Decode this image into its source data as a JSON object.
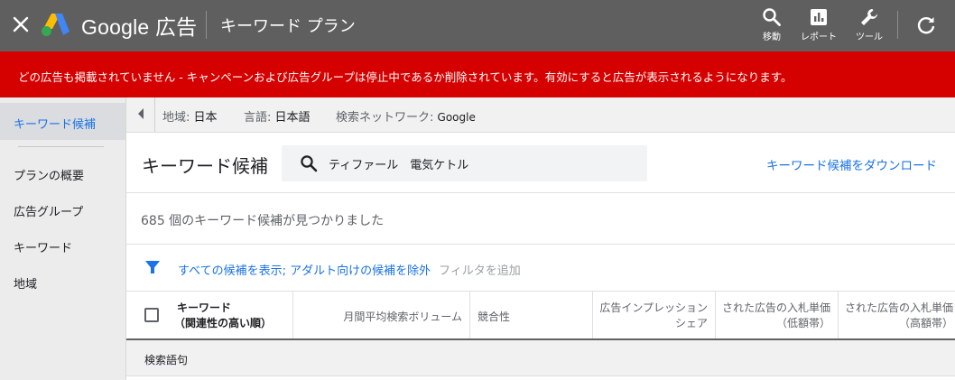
{
  "topbar": {
    "brand": "Google 広告",
    "page_title": "キーワード プラン",
    "tools": [
      {
        "label": "移動",
        "icon": "search-icon"
      },
      {
        "label": "レポート",
        "icon": "report-icon"
      },
      {
        "label": "ツール",
        "icon": "wrench-icon"
      }
    ],
    "background": "#5f5f5f"
  },
  "alert": {
    "text": "どの広告も掲載されていません - キャンペーンおよび広告グループは停止中であるか削除されています。有効にすると広告が表示されるようになります。",
    "color": "#d50000"
  },
  "sidebar": {
    "items": [
      {
        "label": "キーワード候補",
        "active": true
      },
      {
        "label": "プランの概要"
      },
      {
        "label": "広告グループ"
      },
      {
        "label": "キーワード"
      },
      {
        "label": "地域"
      }
    ]
  },
  "filterbar": {
    "region_label": "地域:",
    "region_value": "日本",
    "language_label": "言語:",
    "language_value": "日本語",
    "network_label": "検索ネットワーク:",
    "network_value": "Google"
  },
  "main": {
    "title": "キーワード候補",
    "search_value": "ティファール　電気ケトル",
    "download_link": "キーワード候補をダウンロード",
    "found_text": "685 個のキーワード候補が見つかりました",
    "filter_text": "すべての候補を表示; アダルト向けの候補を除外",
    "filter_add": "フィルタを追加",
    "accent": "#1a73e8"
  },
  "table": {
    "columns": [
      {
        "line1": "キーワード",
        "line2": "（関連性の高い順）"
      },
      {
        "line1": "月間平均検索ボリューム",
        "line2": ""
      },
      {
        "line1": "競合性",
        "line2": ""
      },
      {
        "line1": "広告インプレッション",
        "line2": "シェア"
      },
      {
        "line1": "された広告の入札単価",
        "line2": "（低額帯）"
      },
      {
        "line1": "された広告の入札単価",
        "line2": "（高額帯）"
      }
    ],
    "section_label": "検索語句"
  }
}
